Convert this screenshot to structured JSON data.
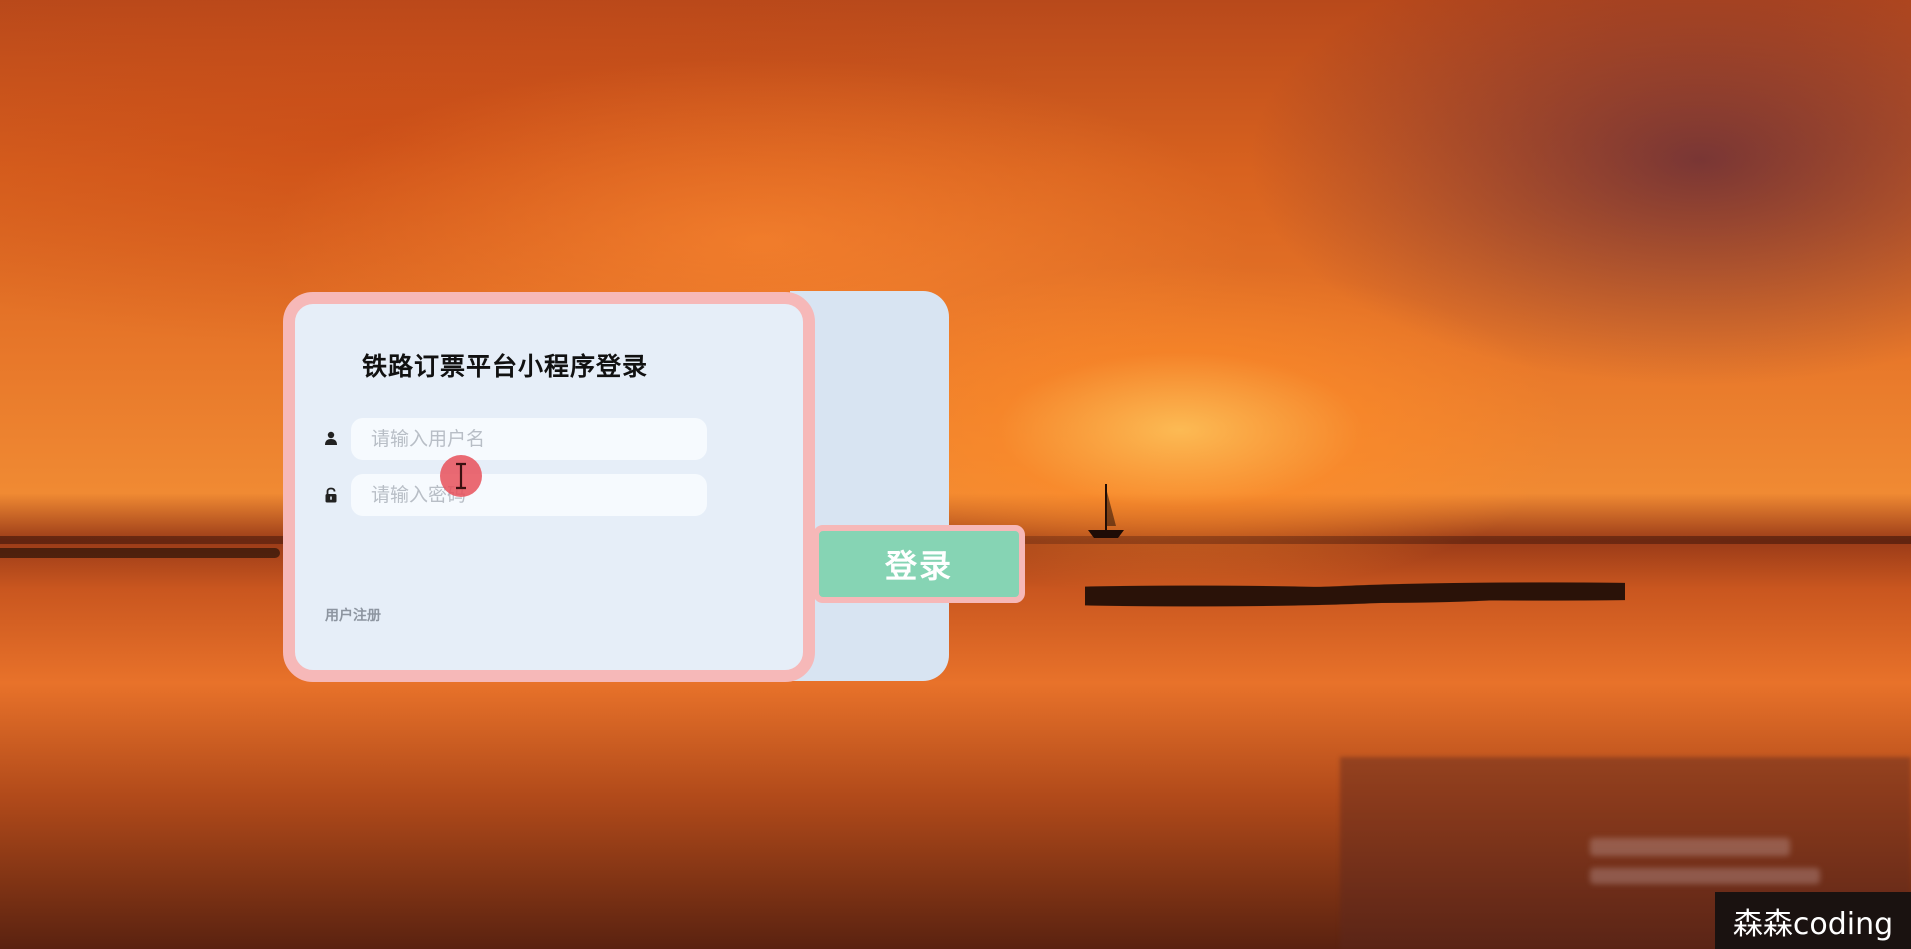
{
  "login": {
    "title": "铁路订票平台小程序登录",
    "username_placeholder": "请输入用户名",
    "password_placeholder": "请输入密码",
    "register_link": "用户注册",
    "login_button": "登录"
  },
  "icons": {
    "username": "user-icon",
    "password": "lock-icon",
    "cursor": "text-cursor-icon"
  },
  "colors": {
    "card_border": "#f6b8b8",
    "card_bg": "#e6eef8",
    "login_button_bg": "#86d4b4",
    "cursor_highlight": "#e8505a"
  },
  "watermark": "森森coding"
}
